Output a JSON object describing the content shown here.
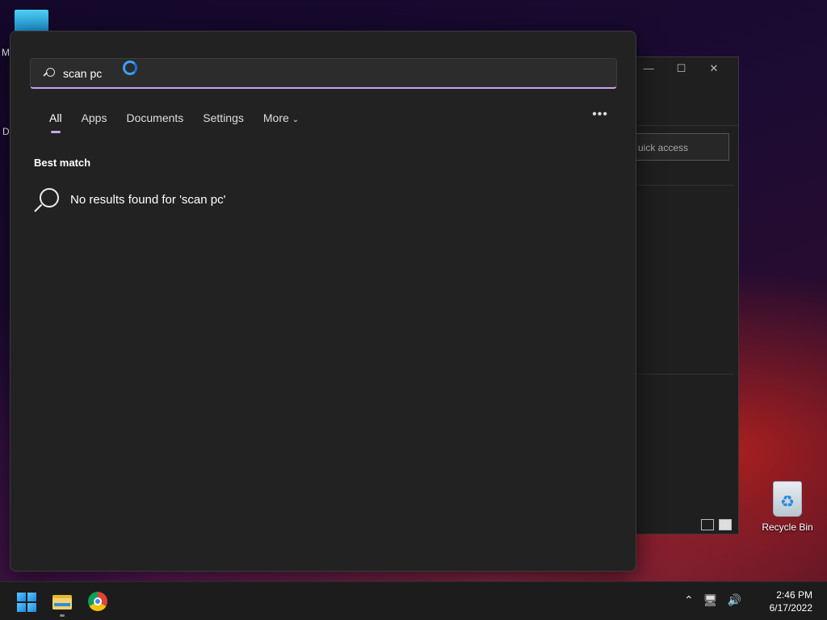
{
  "desktop": {
    "peek_m": "M",
    "peek_d": "D",
    "recycle_bin_label": "Recycle Bin"
  },
  "background_window": {
    "search_placeholder": "uick access",
    "minimize": "—",
    "maximize": "☐",
    "close": "✕"
  },
  "search": {
    "query": "scan pc",
    "tabs": [
      {
        "label": "All"
      },
      {
        "label": "Apps"
      },
      {
        "label": "Documents"
      },
      {
        "label": "Settings"
      },
      {
        "label": "More"
      }
    ],
    "more_options": "•••",
    "section_title": "Best match",
    "no_results": "No results found for 'scan pc'"
  },
  "taskbar": {
    "time": "2:46 PM",
    "date": "6/17/2022",
    "icons": [
      "start-icon",
      "file-explorer-icon",
      "chrome-icon"
    ],
    "tray": [
      "chevron-up-icon",
      "network-icon",
      "volume-icon"
    ]
  },
  "colors": {
    "accent": "#c7a6e8",
    "panel_bg": "#222222",
    "taskbar_bg": "#1c1c1c"
  }
}
